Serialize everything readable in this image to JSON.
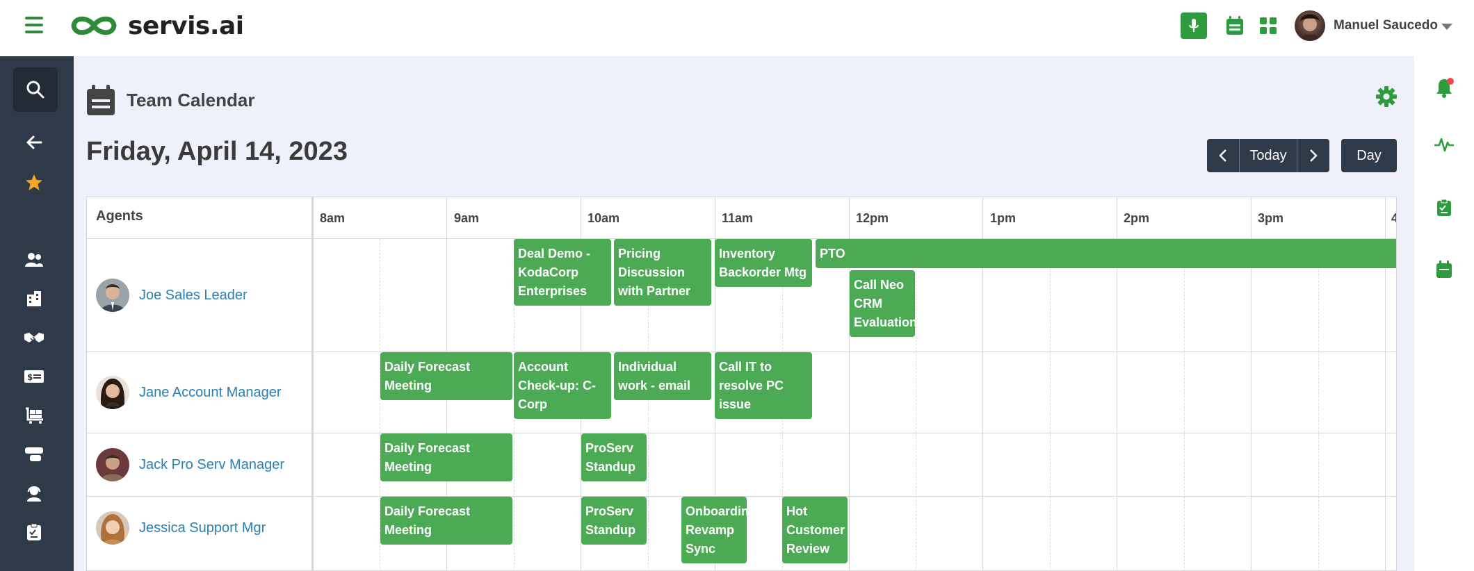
{
  "header": {
    "logo_text": "servis.ai",
    "user_name": "Manuel Saucedo",
    "brand_color": "#2e9c3e",
    "icons": [
      "menu-icon",
      "mic-icon",
      "calendar-icon",
      "apps-grid-icon",
      "user-avatar",
      "chevron-down-icon"
    ]
  },
  "sidebar": {
    "items": [
      "search-icon",
      "back-arrow-icon",
      "star-icon",
      "contacts-icon",
      "companies-icon",
      "deals-icon",
      "billing-icon",
      "inventory-icon",
      "tickets-icon",
      "support-icon",
      "tasks-icon"
    ]
  },
  "rightbar": {
    "items": [
      "notifications-bell-icon",
      "activity-pulse-icon",
      "clipboard-check-icon",
      "calendar-icon"
    ],
    "notification_dot_color": "#e94b4b"
  },
  "page": {
    "title": "Team Calendar",
    "date": "Friday, April 14, 2023",
    "today_label": "Today",
    "view_label": "Day"
  },
  "calendar": {
    "agents_header": "Agents",
    "hours": [
      "8am",
      "9am",
      "10am",
      "11am",
      "12pm",
      "1pm",
      "2pm",
      "3pm",
      "4"
    ],
    "agents": [
      {
        "name": "Joe Sales Leader",
        "events": [
          {
            "title": "Deal Demo - KodaCorp Enterprises",
            "start": "9:30am",
            "end": "10:15am"
          },
          {
            "title": "Pricing Discussion with Partner",
            "start": "10:15am",
            "end": "11:00am"
          },
          {
            "title": "Inventory Backorder Mtg",
            "start": "11:00am",
            "end": "11:45am"
          },
          {
            "title": "PTO",
            "start": "11:45am",
            "end": "4pm"
          },
          {
            "title": "Call Neo CRM Evaluation",
            "start": "12:00pm",
            "end": "12:30pm"
          }
        ]
      },
      {
        "name": "Jane Account Manager",
        "events": [
          {
            "title": "Daily Forecast Meeting",
            "start": "8:30am",
            "end": "9:30am"
          },
          {
            "title": "Account Check-up: C-Corp",
            "start": "9:30am",
            "end": "10:15am"
          },
          {
            "title": "Individual work - email",
            "start": "10:15am",
            "end": "11:00am"
          },
          {
            "title": "Call IT to resolve PC issue",
            "start": "11:00am",
            "end": "11:45am"
          }
        ]
      },
      {
        "name": "Jack Pro Serv Manager",
        "events": [
          {
            "title": "Daily Forecast Meeting",
            "start": "8:30am",
            "end": "9:30am"
          },
          {
            "title": "ProServ Standup",
            "start": "10:00am",
            "end": "10:30am"
          }
        ]
      },
      {
        "name": "Jessica Support Mgr",
        "events": [
          {
            "title": "Daily Forecast Meeting",
            "start": "8:30am",
            "end": "9:30am"
          },
          {
            "title": "ProServ Standup",
            "start": "10:00am",
            "end": "10:30am"
          },
          {
            "title": "Onboarding Revamp Sync",
            "start": "10:45am",
            "end": "11:15am"
          },
          {
            "title": "Hot Customer Review",
            "start": "11:30am",
            "end": "12:00pm"
          }
        ]
      }
    ],
    "event_color": "#4caa55"
  }
}
